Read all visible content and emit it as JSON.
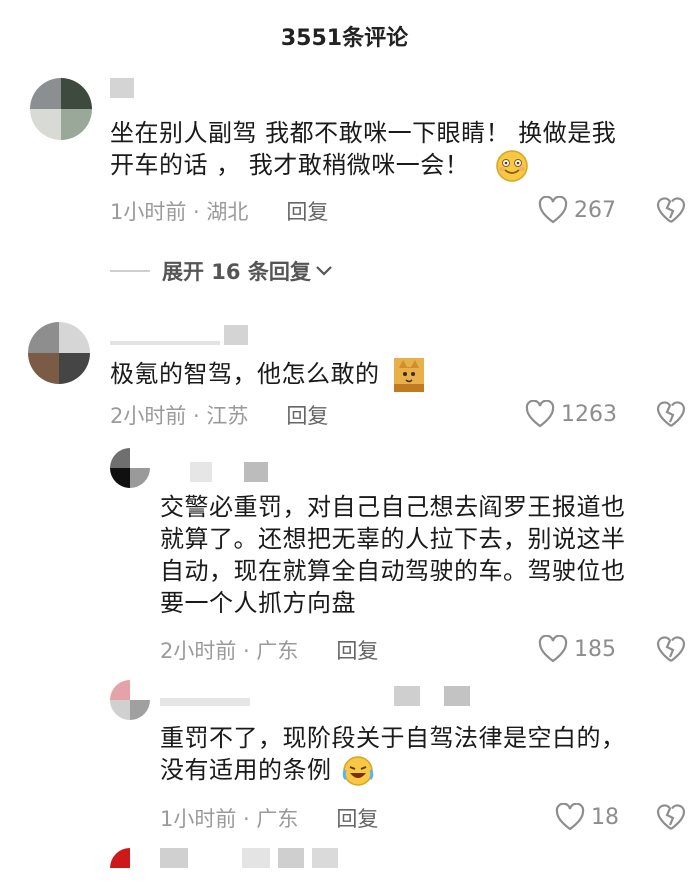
{
  "header": {
    "title": "3551条评论"
  },
  "comments": [
    {
      "lines": [
        "坐在别人副驾 我都不敢咪一下眼睛！ 换做是我",
        "开车的话 ， 我才敢稍微咪一会！"
      ],
      "time": "1小时前 · 湖北",
      "reply": "回复",
      "likes": "267",
      "emoji": "smile-emoji"
    },
    {
      "lines": [
        "极氪的智驾，他怎么敢的"
      ],
      "time": "2小时前 · 江苏",
      "reply": "回复",
      "likes": "1263",
      "emoji": "cat-sticker"
    },
    {
      "lines": [
        "交警必重罚，对自己自己想去阎罗王报道也",
        "就算了。还想把无辜的人拉下去，别说这半",
        "自动，现在就算全自动驾驶的车。驾驶位也",
        "要一个人抓方向盘"
      ],
      "time": "2小时前 · 广东",
      "reply": "回复",
      "likes": "185"
    },
    {
      "lines": [
        "重罚不了，现阶段关于自驾法律是空白的，",
        "没有适用的条例"
      ],
      "time": "1小时前 · 广东",
      "reply": "回复",
      "likes": "18",
      "emoji": "laugh-cry-emoji"
    }
  ],
  "expand": {
    "label": "展开 16 条回复"
  },
  "colors": {
    "meta": "#9a9a9a",
    "text": "#1a1a1a"
  }
}
